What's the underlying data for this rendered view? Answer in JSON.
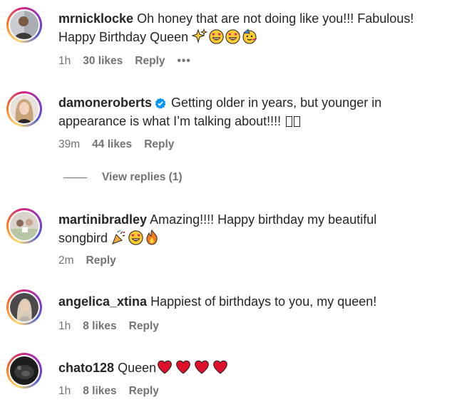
{
  "comments": [
    {
      "username": "mrnicklocke",
      "text_line1": "Oh honey that are not doing like you!!! Fabulous!",
      "text_line2": "Happy Birthday Queen",
      "time": "1h",
      "likes": "30 likes",
      "reply": "Reply",
      "more": "•••"
    },
    {
      "username": "damoneroberts",
      "text_line1": "Getting older in years, but younger in",
      "text_line2": "appearance is what I’m talking about!!!!",
      "time": "39m",
      "likes": "44 likes",
      "reply": "Reply",
      "view_replies": "View replies (1)"
    },
    {
      "username": "martinibradley",
      "text_line1": "Amazing!!!! Happy birthday my beautiful",
      "text_line2": "songbird",
      "time": "2m",
      "reply": "Reply"
    },
    {
      "username": "angelica_xtina",
      "text_line1": "Happiest of birthdays to you, my queen!",
      "time": "1h",
      "likes": "8 likes",
      "reply": "Reply"
    },
    {
      "username": "chato128",
      "text_line1": "Queen",
      "time": "1h",
      "likes": "8 likes",
      "reply": "Reply"
    }
  ],
  "icons": {
    "sparkles": "sparkles-icon",
    "heart_eyes": "heart-eyes-emoji",
    "party_face": "partying-face-emoji",
    "party_popper": "party-popper-emoji",
    "fire": "fire-emoji",
    "red_heart": "red-heart-emoji",
    "verified": "verified-badge-icon"
  },
  "colors": {
    "verified_blue": "#0095f6",
    "meta_gray": "#737373",
    "text": "#262626"
  }
}
